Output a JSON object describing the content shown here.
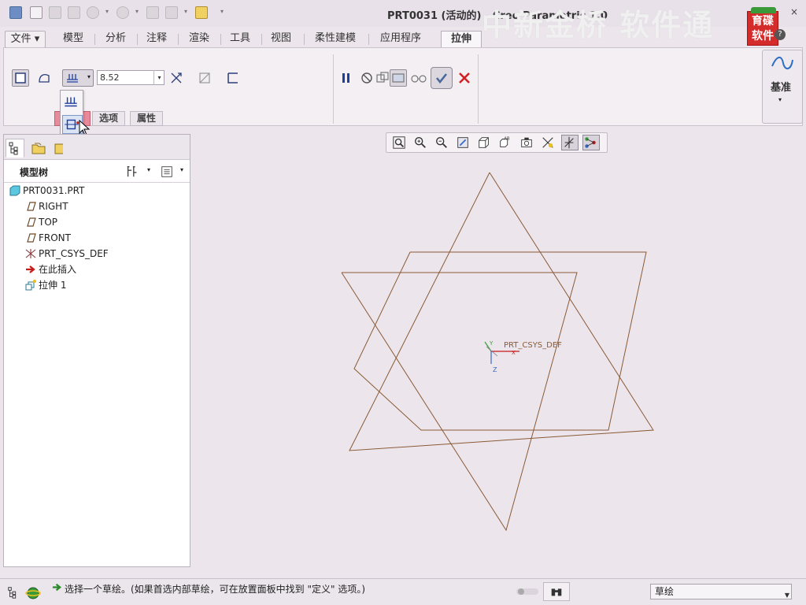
{
  "window": {
    "title": "PRT0031 (活动的) - Creo Parametric 1.0",
    "watermark": "中新金桥 软件通",
    "badge_text_line1": "育碟",
    "badge_text_line2": "软件",
    "close_label": "×",
    "help_label": "?"
  },
  "ribbon_tabs": [
    {
      "label": "文件 ▾"
    },
    {
      "label": "模型"
    },
    {
      "label": "分析"
    },
    {
      "label": "注释"
    },
    {
      "label": "渲染"
    },
    {
      "label": "工具"
    },
    {
      "label": "视图"
    },
    {
      "label": "柔性建模"
    },
    {
      "label": "应用程序"
    },
    {
      "label": "拉伸"
    }
  ],
  "extrude": {
    "depth_value": "8.52",
    "depth_options": [
      "blind-depth",
      "symmetric",
      "to-selected"
    ],
    "subtabs": [
      "选项",
      "属性"
    ],
    "datum_label": "基准"
  },
  "model_tree": {
    "title": "模型树",
    "items": [
      {
        "label": "PRT0031.PRT",
        "icon": "part-icon"
      },
      {
        "label": "RIGHT",
        "icon": "datum-plane-icon"
      },
      {
        "label": "TOP",
        "icon": "datum-plane-icon"
      },
      {
        "label": "FRONT",
        "icon": "datum-plane-icon"
      },
      {
        "label": "PRT_CSYS_DEF",
        "icon": "csys-icon"
      },
      {
        "label": "在此插入",
        "icon": "insert-here-arrow-icon"
      },
      {
        "label": "拉伸 1",
        "icon": "extrude-feature-icon"
      }
    ]
  },
  "graphics": {
    "csys_label": "PRT_CSYS_DEF",
    "sketch_color": "#8a5a36"
  },
  "status": {
    "message": "选择一个草绘。(如果首选内部草绘，可在放置面板中找到 \"定义\" 选项。)",
    "filter_value": "草绘"
  },
  "colors": {
    "accent_blue": "#1f3f9f",
    "confirm_green": "#3a9a3a",
    "cancel_red": "#d42020"
  }
}
